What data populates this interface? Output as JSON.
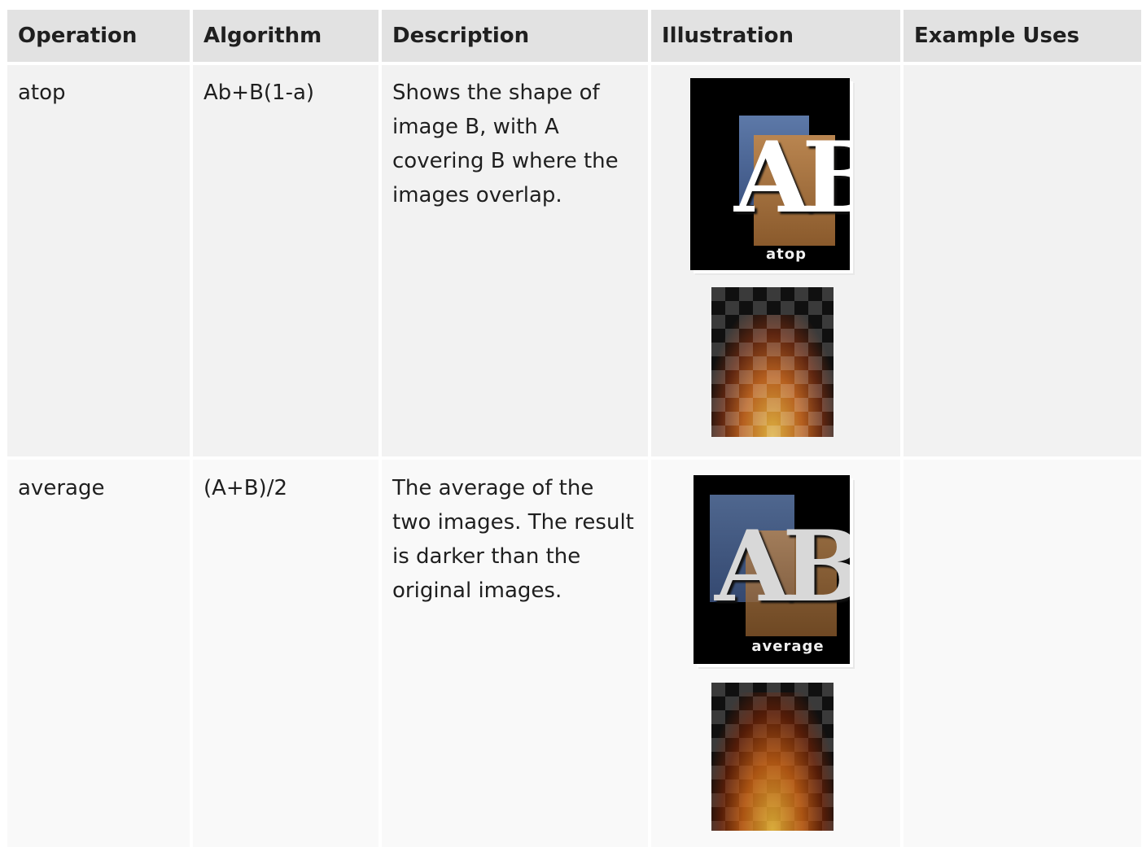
{
  "table": {
    "headers": [
      "Operation",
      "Algorithm",
      "Description",
      "Illustration",
      "Example Uses"
    ],
    "rows": [
      {
        "operation": "atop",
        "algorithm": "Ab+B(1-a)",
        "description": "Shows the shape of image B, with A covering B where the images overlap.",
        "illustration_caption": "atop",
        "illustration_letters": "AB",
        "example_uses": ""
      },
      {
        "operation": "average",
        "algorithm": "(A+B)/2",
        "description": "The average of the two images. The result is darker than the original images.",
        "illustration_caption": "average",
        "illustration_letters": "AB",
        "example_uses": ""
      }
    ]
  },
  "colors": {
    "header_bg": "#e2e2e2",
    "row1_bg": "#f2f2f2",
    "row2_bg": "#f9f9f9",
    "square_a": "#4c6796",
    "square_b": "#a8743f"
  }
}
